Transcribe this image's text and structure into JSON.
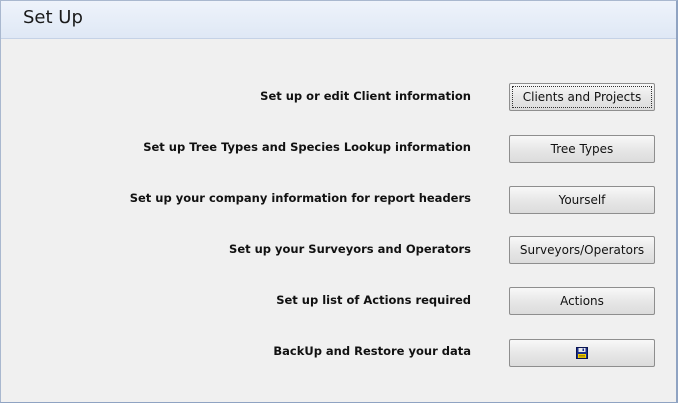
{
  "window": {
    "title": "Set Up"
  },
  "rows": [
    {
      "label": "Set up or edit Client information",
      "button_label": "Clients and Projects"
    },
    {
      "label": "Set up Tree Types and Species Lookup information",
      "button_label": "Tree Types"
    },
    {
      "label": "Set up your company information for report headers",
      "button_label": "Yourself"
    },
    {
      "label": "Set up your Surveyors and Operators",
      "button_label": "Surveyors/Operators"
    },
    {
      "label": "Set up list of Actions required",
      "button_label": "Actions"
    },
    {
      "label": "BackUp and Restore your data",
      "button_icon": "save-disk-icon"
    }
  ],
  "colors": {
    "header_bg": "#dfe8f5",
    "body_bg": "#f0f0f0",
    "border": "#8fa3c2"
  }
}
